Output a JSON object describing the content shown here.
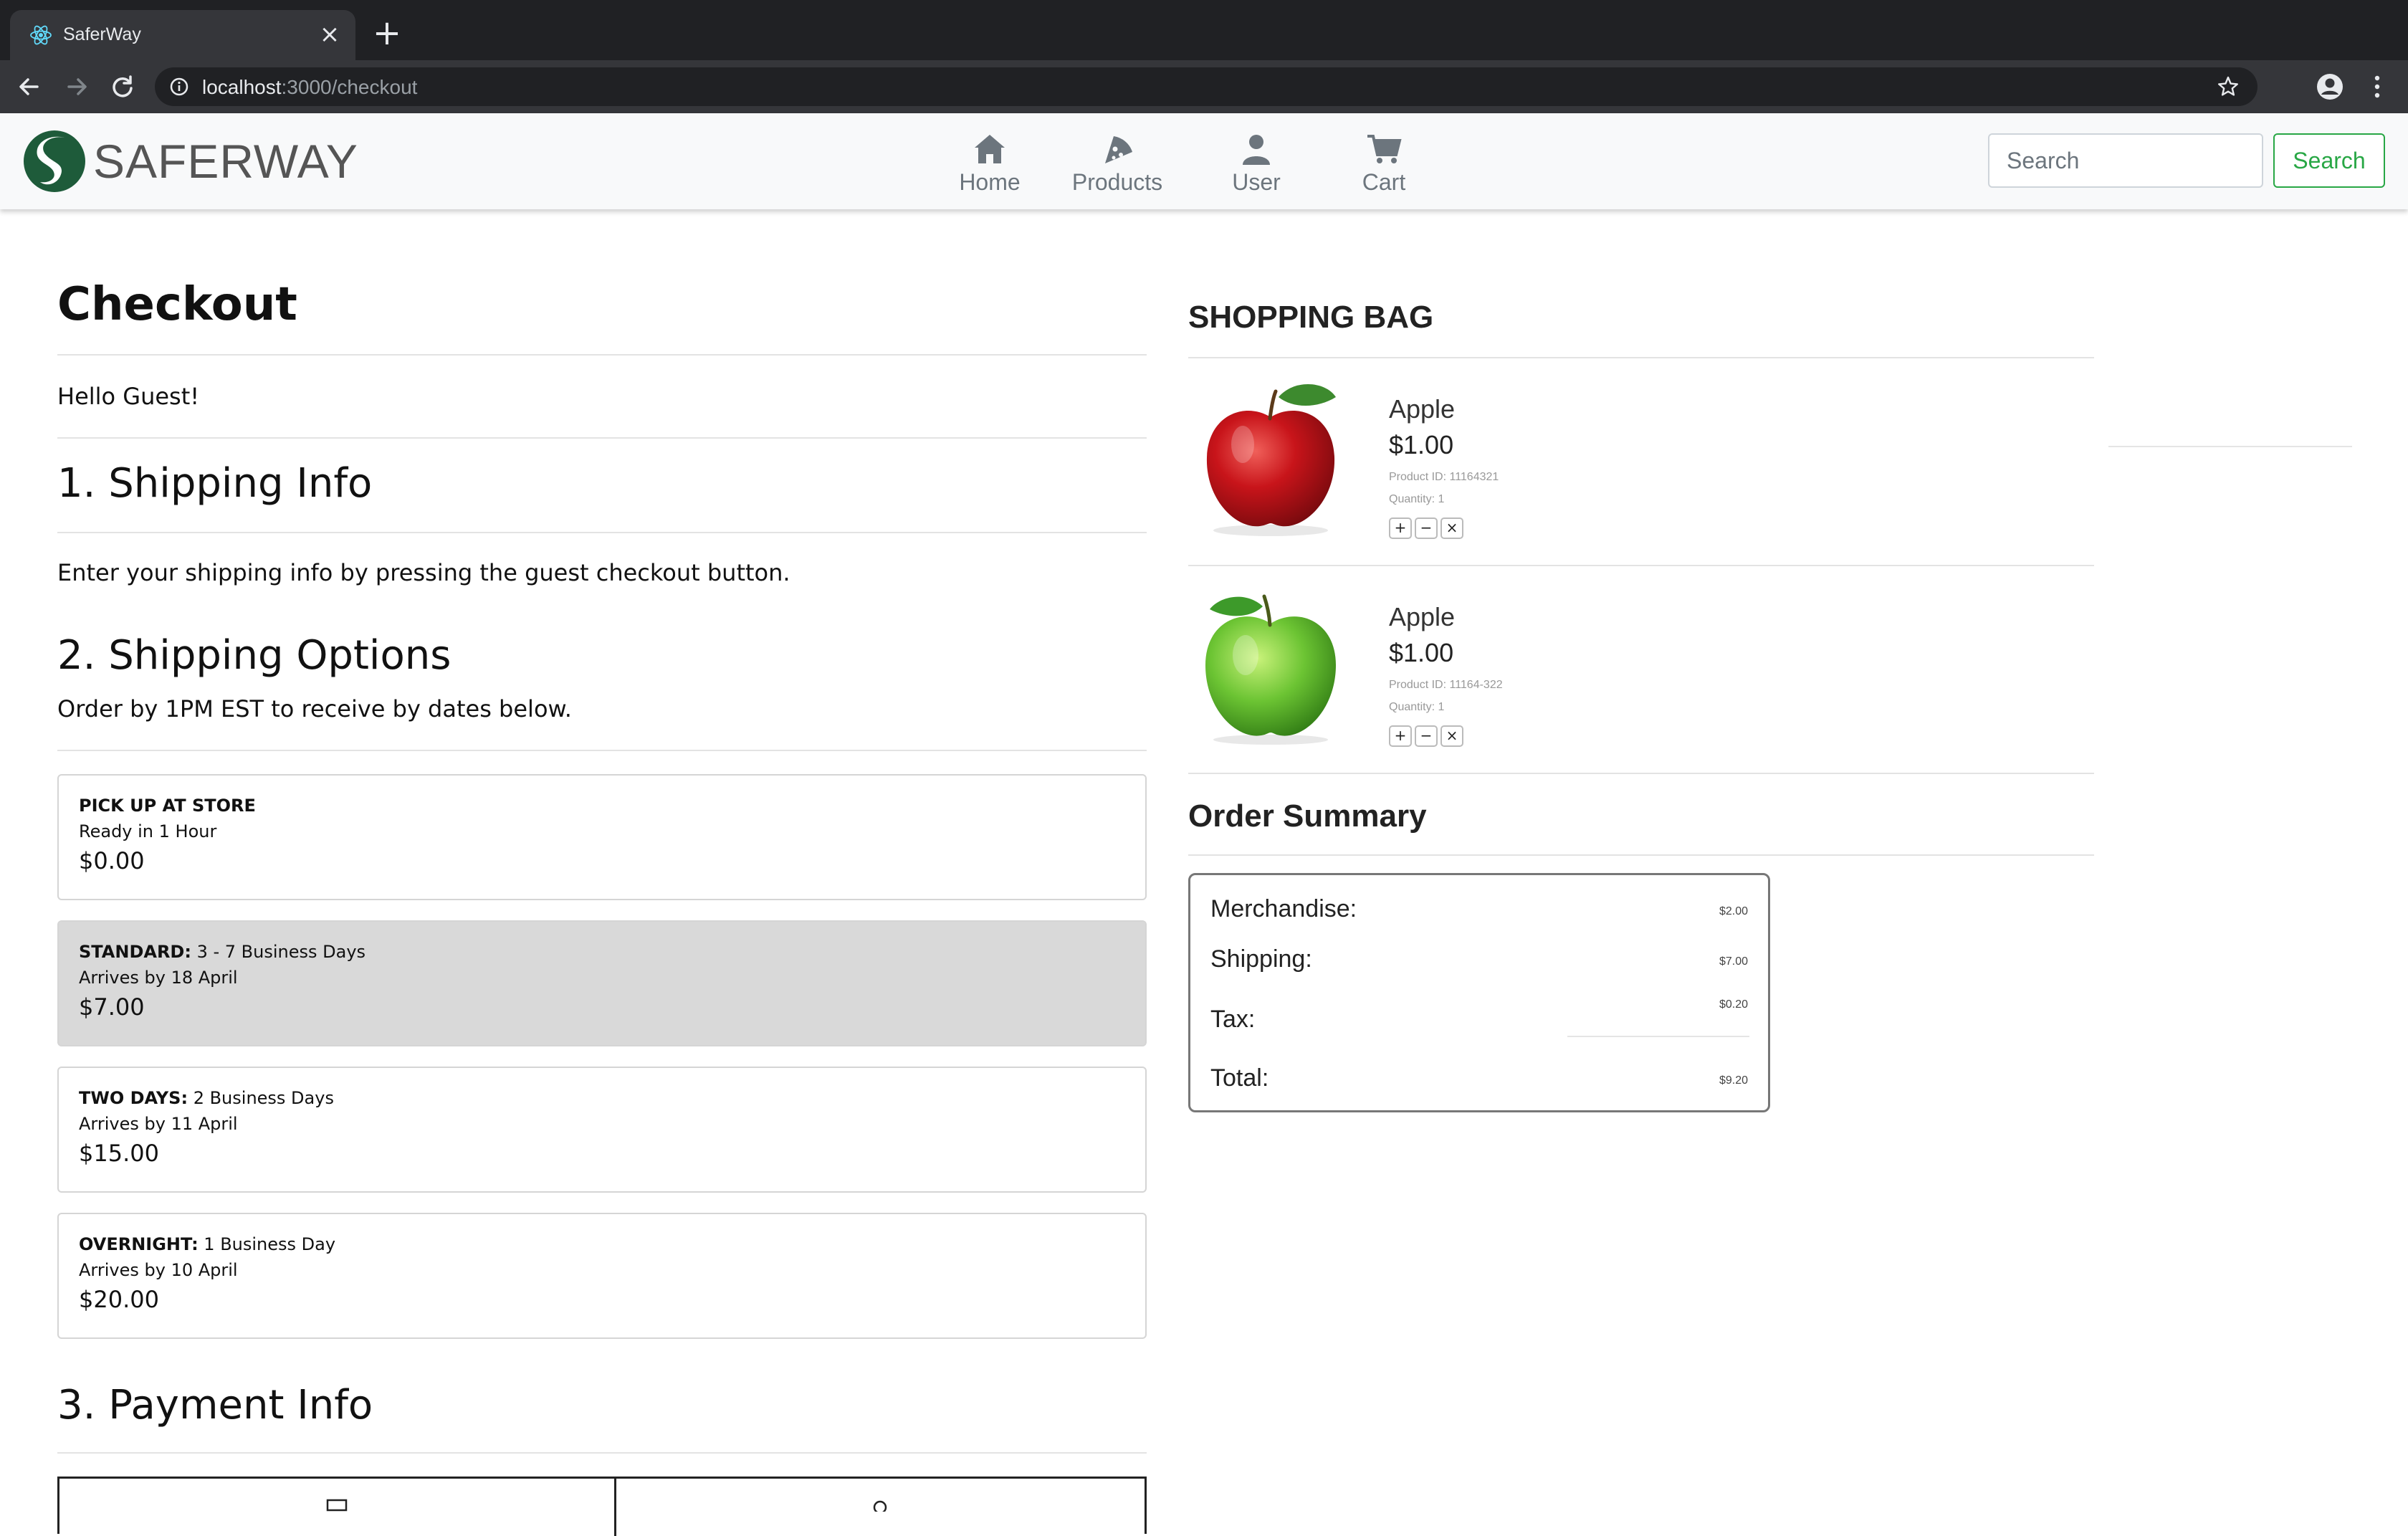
{
  "browser": {
    "tab_title": "SaferWay",
    "url_host": "localhost",
    "url_path": ":3000/checkout"
  },
  "navbar": {
    "brand": "SAFERWAY",
    "items": [
      {
        "label": "Home",
        "icon": "home-icon"
      },
      {
        "label": "Products",
        "icon": "pizza-icon"
      },
      {
        "label": "User",
        "icon": "user-icon"
      },
      {
        "label": "Cart",
        "icon": "cart-icon"
      }
    ],
    "search_placeholder": "Search",
    "search_button": "Search"
  },
  "checkout": {
    "title": "Checkout",
    "greeting": "Hello Guest!",
    "shipping_info_heading": "1. Shipping Info",
    "shipping_info_text": "Enter your shipping info by pressing the guest checkout button.",
    "shipping_options_heading": "2. Shipping Options",
    "shipping_options_text": "Order by 1PM EST to receive by dates below.",
    "options": [
      {
        "name": "PICK UP AT STORE",
        "detail": "",
        "arrives": "Ready in 1 Hour",
        "price": "$0.00",
        "selected": false
      },
      {
        "name": "STANDARD:",
        "detail": " 3 - 7 Business Days",
        "arrives": "Arrives by 18 April",
        "price": "$7.00",
        "selected": true
      },
      {
        "name": "TWO DAYS:",
        "detail": " 2 Business Days",
        "arrives": "Arrives by 11 April",
        "price": "$15.00",
        "selected": false
      },
      {
        "name": "OVERNIGHT:",
        "detail": " 1 Business Day",
        "arrives": "Arrives by 10 April",
        "price": "$20.00",
        "selected": false
      }
    ],
    "payment_heading": "3. Payment Info"
  },
  "bag": {
    "heading": "SHOPPING BAG",
    "items": [
      {
        "name": "Apple",
        "price": "$1.00",
        "product_id": "Product ID: 11164321",
        "quantity": "Quantity: 1",
        "color": "red"
      },
      {
        "name": "Apple",
        "price": "$1.00",
        "product_id": "Product ID: 11164-322",
        "quantity": "Quantity: 1",
        "color": "green"
      }
    ],
    "qty_buttons": {
      "plus": "+",
      "minus": "−",
      "remove": "×"
    }
  },
  "summary": {
    "heading": "Order Summary",
    "merchandise_label": "Merchandise:",
    "merchandise": "$2.00",
    "shipping_label": "Shipping:",
    "shipping": "$7.00",
    "tax_label": "Tax:",
    "tax": "$0.20",
    "total_label": "Total:",
    "total": "$9.20"
  },
  "colors": {
    "brand_green": "#28a745",
    "logo_green": "#1e5b3a",
    "selected_option_bg": "#d9d9d9"
  }
}
